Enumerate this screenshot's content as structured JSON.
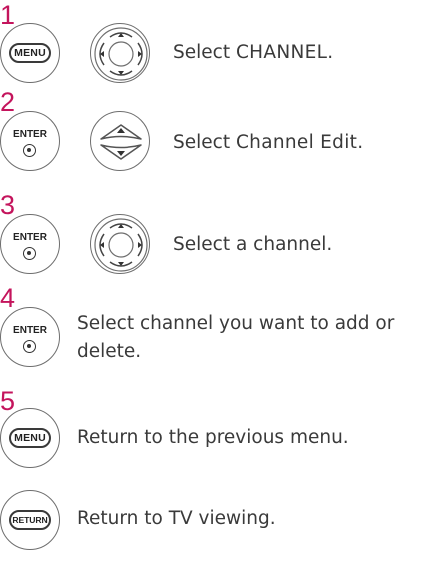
{
  "colors": {
    "step_number": "#c4145c",
    "text": "#3a3a3a",
    "button_outline": "#6e6e6e"
  },
  "steps": [
    {
      "number": "1",
      "button": "MENU",
      "text_prefix": "Select ",
      "text_bold": "CHANNEL",
      "text_suffix": "."
    },
    {
      "number": "2",
      "button": "ENTER",
      "text_prefix": "Select ",
      "text_bold": "Channel Edit",
      "text_suffix": "."
    },
    {
      "number": "3",
      "button": "ENTER",
      "text": "Select a channel."
    },
    {
      "number": "4",
      "button": "ENTER",
      "text_line1": "Select channel you want to add or",
      "text_line2": "delete."
    },
    {
      "number": "5",
      "button": "MENU",
      "text": "Return to the previous menu."
    },
    {
      "button": "RETURN",
      "text": "Return to TV viewing."
    }
  ],
  "icons": {
    "nav_ring": "four-way-navigation-icon",
    "updown": "up-down-navigation-icon"
  }
}
